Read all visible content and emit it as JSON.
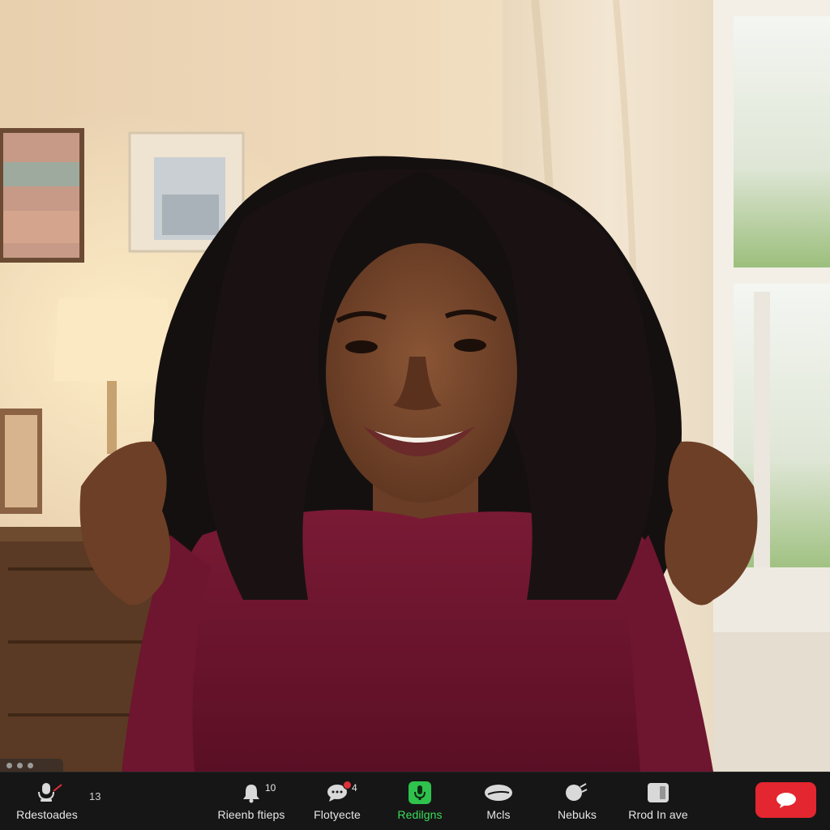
{
  "toolbar": {
    "items": [
      {
        "id": "mute",
        "label": "Rdestoades",
        "icon": "mic-muted-icon"
      },
      {
        "id": "reactions",
        "label": "Rieenb ftieps",
        "count": "10",
        "icon": "bell-icon"
      },
      {
        "id": "chat",
        "label": "Flotyecte",
        "count": "4",
        "icon": "chat-bubble-icon"
      },
      {
        "id": "record",
        "label": "Redilgns",
        "icon": "green-mic-icon",
        "active": true
      },
      {
        "id": "mics",
        "label": "Mcls",
        "icon": "cloud-icon"
      },
      {
        "id": "nebuks",
        "label": "Nebuks",
        "icon": "search-icon"
      },
      {
        "id": "leave",
        "label": "Rrod In ave",
        "icon": "square-icon"
      }
    ],
    "side_count": "13",
    "end_icon": "chat-end-icon"
  },
  "colors": {
    "toolbar_bg": "#161616",
    "active_green": "#3ddc5a",
    "end_red": "#e3262f"
  }
}
